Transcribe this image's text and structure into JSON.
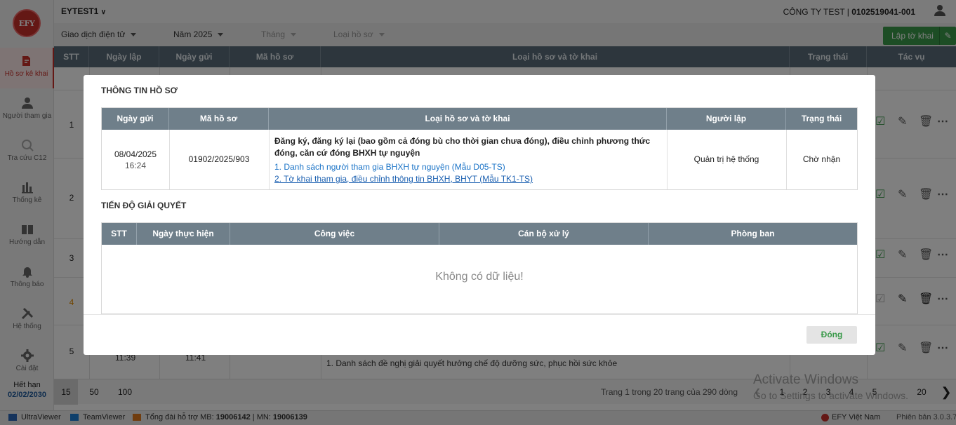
{
  "app": {
    "logo_text": "EFY",
    "account": "EYTEST1",
    "company_name": "CÔNG TY TEST | ",
    "tax_code": "0102519041-001"
  },
  "sidebar": {
    "items": [
      {
        "label": "Hồ sơ kê khai",
        "icon": "file-edit-icon"
      },
      {
        "label": "Người tham gia",
        "icon": "user-icon"
      },
      {
        "label": "Tra cứu C12",
        "icon": "search-icon"
      },
      {
        "label": "Thống kê",
        "icon": "bar-chart-icon"
      },
      {
        "label": "Hướng dẫn",
        "icon": "book-icon"
      },
      {
        "label": "Thông báo",
        "icon": "bell-icon"
      },
      {
        "label": "Hệ thống",
        "icon": "tools-icon"
      },
      {
        "label": "Cài đặt",
        "icon": "gear-icon"
      }
    ],
    "expire_label": "Hết hạn",
    "expire_date": "02/02/2030"
  },
  "filters": {
    "transaction": "Giao dịch điện tử",
    "year": "Năm 2025",
    "month": "Tháng",
    "type": "Loại hồ sơ",
    "create_button": "Lập tờ khai"
  },
  "main_table": {
    "headers": [
      "STT",
      "Ngày lập",
      "Ngày gửi",
      "Mã hồ sơ",
      "Loại hồ sơ và tờ khai",
      "Trạng thái",
      "Tác vụ"
    ],
    "row_numbers": [
      "1",
      "2",
      "3",
      "4",
      "5"
    ],
    "row5_date1_time": "11:39",
    "row5_date2_time": "11:41",
    "row5_item": "1. Danh sách đề nghị giải quyết hưởng chế độ dưỡng sức, phục hồi sức khỏe"
  },
  "pagination": {
    "sizes": [
      "15",
      "50",
      "100"
    ],
    "info": "Trang 1 trong 20 trang của 290 dòng",
    "pages": [
      "1",
      "2",
      "3",
      "4",
      "5",
      "20"
    ]
  },
  "statusbar": {
    "ultraviewer": "UltraViewer",
    "teamviewer": "TeamViewer",
    "hotline_label": "Tổng đài hỗ trợ MB: ",
    "hotline_mb": "19006142",
    "hotline_sep": " | MN: ",
    "hotline_mn": "19006139",
    "brand": "EFY Việt Nam",
    "version": "Phiên bản 3.0.3.7"
  },
  "watermark": {
    "line1": "Activate Windows",
    "line2": "Go to Settings to activate Windows."
  },
  "modal": {
    "title": "THÔNG TIN HỒ SƠ",
    "info_headers": [
      "Ngày gửi",
      "Mã hồ sơ",
      "Loại hồ sơ và tờ khai",
      "Người lập",
      "Trạng thái"
    ],
    "sent_date": "08/04/2025",
    "sent_time": "16:24",
    "code": "01902/2025/903",
    "type_line1": "Đăng ký, đăng ký lại (bao gồm cả đóng bù cho thời gian chưa đóng), điều chỉnh phương thức",
    "type_line2": "đóng, căn cứ đóng BHXH tự nguyện",
    "link1": "1. Danh sách người tham gia BHXH tự nguyện (Mẫu D05-TS)",
    "link2": "2. Tờ khai tham gia, điều chỉnh thông tin BHXH, BHYT (Mẫu TK1-TS)",
    "creator": "Quản trị hệ thống",
    "status": "Chờ nhận",
    "progress_title": "TIẾN ĐỘ GIẢI QUYẾT",
    "progress_headers": [
      "STT",
      "Ngày thực hiện",
      "Công việc",
      "Cán bộ xử lý",
      "Phòng ban"
    ],
    "empty_text": "Không có dữ liệu!",
    "close_button": "Đóng"
  }
}
